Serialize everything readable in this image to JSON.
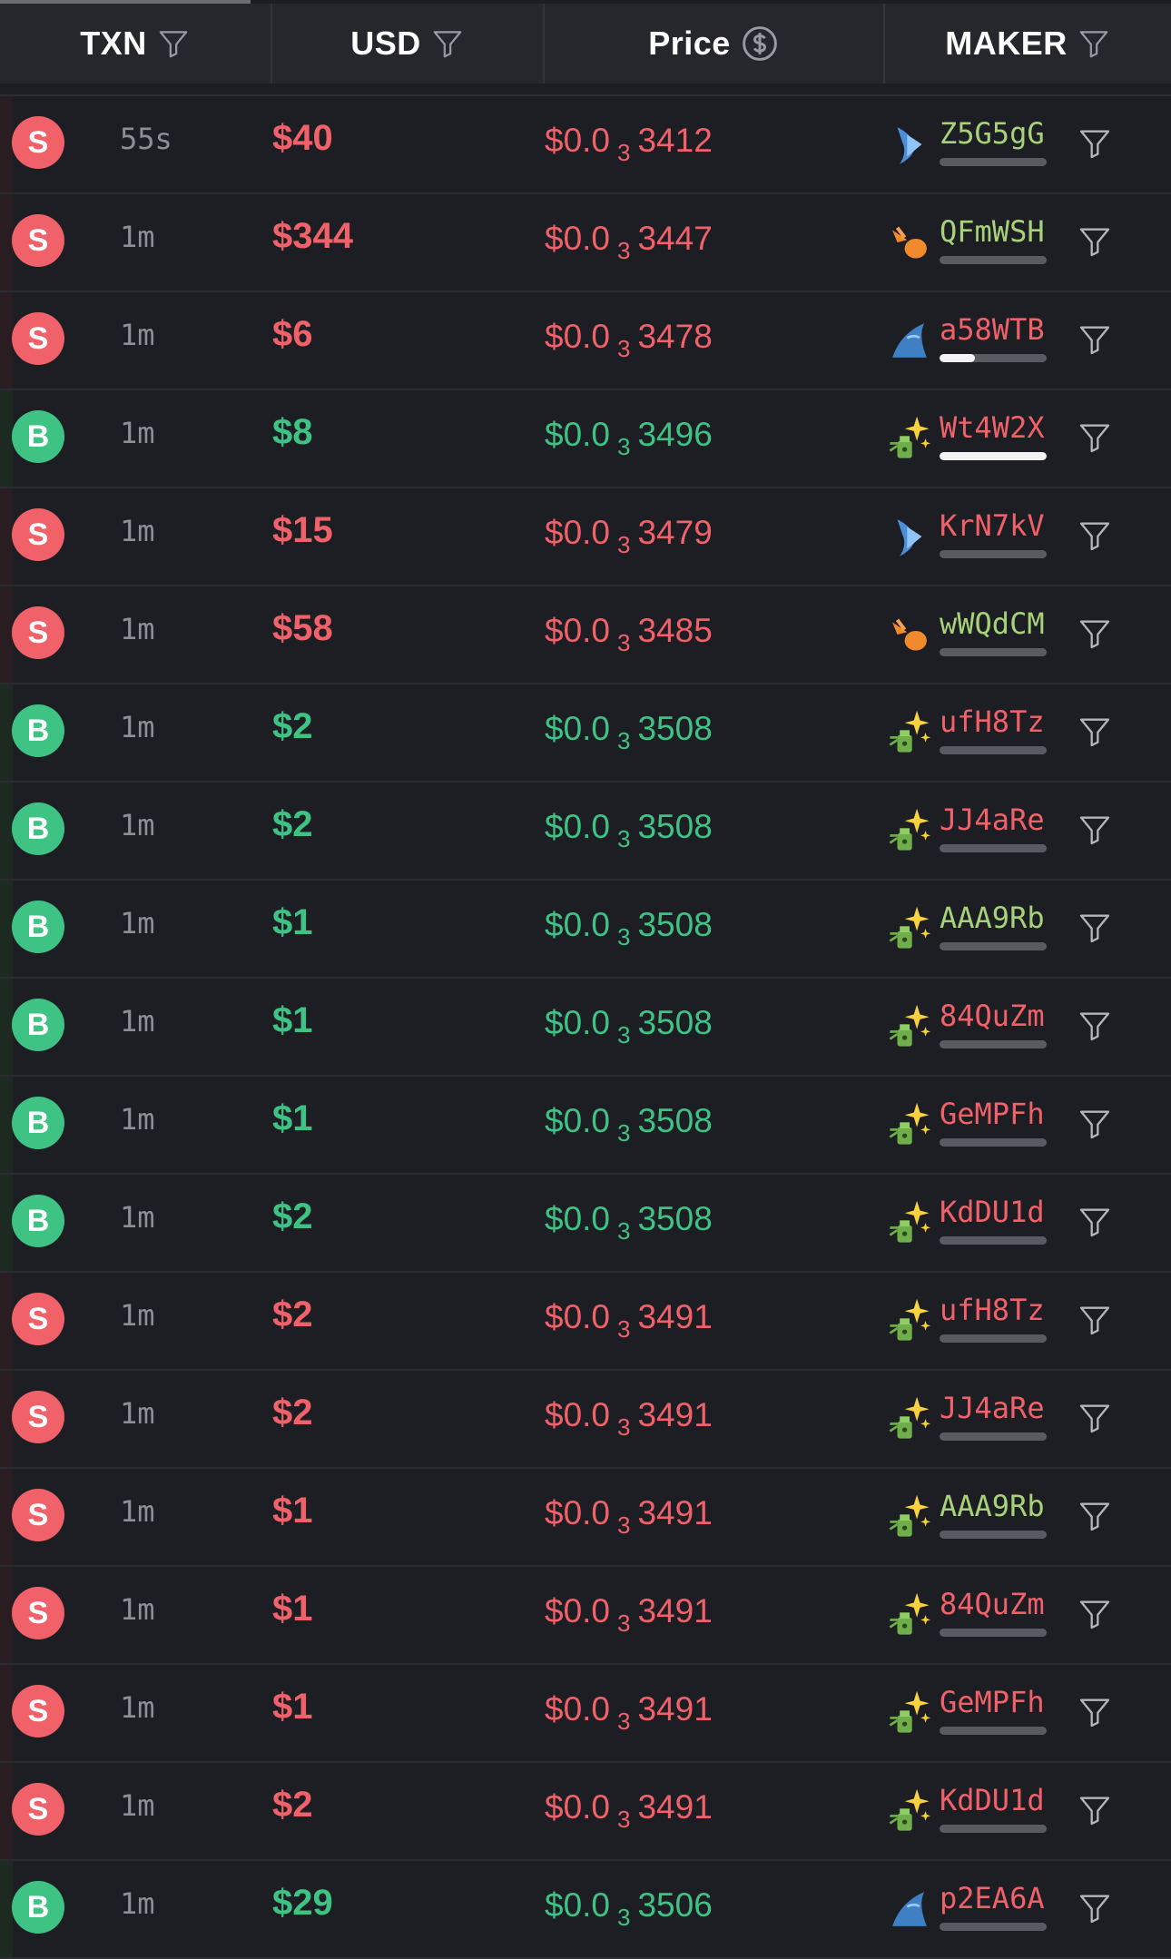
{
  "header": {
    "txn_label": "TXN",
    "usd_label": "USD",
    "price_label": "Price",
    "maker_label": "MAKER"
  },
  "colors": {
    "sell": "#f0616a",
    "buy": "#3fc384",
    "maker_green": "#a8d27a",
    "background": "#1d1e23",
    "header_bg": "#26272c"
  },
  "rows": [
    {
      "type": "S",
      "age": "55s",
      "usd": "$40",
      "price_prefix": "$0.0",
      "price_zeros": "3",
      "price_digits": "3412",
      "maker": "Z5G5gG",
      "maker_color": "green",
      "maker_icon": "dolphin-icon",
      "holding": 0
    },
    {
      "type": "S",
      "age": "1m",
      "usd": "$344",
      "price_prefix": "$0.0",
      "price_zeros": "3",
      "price_digits": "3447",
      "maker": "QFmWSH",
      "maker_color": "green",
      "maker_icon": "shrimp-icon",
      "holding": 0
    },
    {
      "type": "S",
      "age": "1m",
      "usd": "$6",
      "price_prefix": "$0.0",
      "price_zeros": "3",
      "price_digits": "3478",
      "maker": "a58WTB",
      "maker_color": "red",
      "maker_icon": "shark-icon",
      "holding": 0.33
    },
    {
      "type": "B",
      "age": "1m",
      "usd": "$8",
      "price_prefix": "$0.0",
      "price_zeros": "3",
      "price_digits": "3496",
      "maker": "Wt4W2X",
      "maker_color": "red",
      "maker_icon": "new-wallet-icon",
      "holding": 1
    },
    {
      "type": "S",
      "age": "1m",
      "usd": "$15",
      "price_prefix": "$0.0",
      "price_zeros": "3",
      "price_digits": "3479",
      "maker": "KrN7kV",
      "maker_color": "red",
      "maker_icon": "dolphin-icon",
      "holding": 0
    },
    {
      "type": "S",
      "age": "1m",
      "usd": "$58",
      "price_prefix": "$0.0",
      "price_zeros": "3",
      "price_digits": "3485",
      "maker": "wWQdCM",
      "maker_color": "green",
      "maker_icon": "shrimp-icon",
      "holding": 0
    },
    {
      "type": "B",
      "age": "1m",
      "usd": "$2",
      "price_prefix": "$0.0",
      "price_zeros": "3",
      "price_digits": "3508",
      "maker": "ufH8Tz",
      "maker_color": "red",
      "maker_icon": "new-wallet-icon",
      "holding": 0
    },
    {
      "type": "B",
      "age": "1m",
      "usd": "$2",
      "price_prefix": "$0.0",
      "price_zeros": "3",
      "price_digits": "3508",
      "maker": "JJ4aRe",
      "maker_color": "red",
      "maker_icon": "new-wallet-icon",
      "holding": 0
    },
    {
      "type": "B",
      "age": "1m",
      "usd": "$1",
      "price_prefix": "$0.0",
      "price_zeros": "3",
      "price_digits": "3508",
      "maker": "AAA9Rb",
      "maker_color": "green",
      "maker_icon": "new-wallet-icon",
      "holding": 0
    },
    {
      "type": "B",
      "age": "1m",
      "usd": "$1",
      "price_prefix": "$0.0",
      "price_zeros": "3",
      "price_digits": "3508",
      "maker": "84QuZm",
      "maker_color": "red",
      "maker_icon": "new-wallet-icon",
      "holding": 0
    },
    {
      "type": "B",
      "age": "1m",
      "usd": "$1",
      "price_prefix": "$0.0",
      "price_zeros": "3",
      "price_digits": "3508",
      "maker": "GeMPFh",
      "maker_color": "red",
      "maker_icon": "new-wallet-icon",
      "holding": 0
    },
    {
      "type": "B",
      "age": "1m",
      "usd": "$2",
      "price_prefix": "$0.0",
      "price_zeros": "3",
      "price_digits": "3508",
      "maker": "KdDU1d",
      "maker_color": "red",
      "maker_icon": "new-wallet-icon",
      "holding": 0
    },
    {
      "type": "S",
      "age": "1m",
      "usd": "$2",
      "price_prefix": "$0.0",
      "price_zeros": "3",
      "price_digits": "3491",
      "maker": "ufH8Tz",
      "maker_color": "red",
      "maker_icon": "new-wallet-icon",
      "holding": 0
    },
    {
      "type": "S",
      "age": "1m",
      "usd": "$2",
      "price_prefix": "$0.0",
      "price_zeros": "3",
      "price_digits": "3491",
      "maker": "JJ4aRe",
      "maker_color": "red",
      "maker_icon": "new-wallet-icon",
      "holding": 0
    },
    {
      "type": "S",
      "age": "1m",
      "usd": "$1",
      "price_prefix": "$0.0",
      "price_zeros": "3",
      "price_digits": "3491",
      "maker": "AAA9Rb",
      "maker_color": "green",
      "maker_icon": "new-wallet-icon",
      "holding": 0
    },
    {
      "type": "S",
      "age": "1m",
      "usd": "$1",
      "price_prefix": "$0.0",
      "price_zeros": "3",
      "price_digits": "3491",
      "maker": "84QuZm",
      "maker_color": "red",
      "maker_icon": "new-wallet-icon",
      "holding": 0
    },
    {
      "type": "S",
      "age": "1m",
      "usd": "$1",
      "price_prefix": "$0.0",
      "price_zeros": "3",
      "price_digits": "3491",
      "maker": "GeMPFh",
      "maker_color": "red",
      "maker_icon": "new-wallet-icon",
      "holding": 0
    },
    {
      "type": "S",
      "age": "1m",
      "usd": "$2",
      "price_prefix": "$0.0",
      "price_zeros": "3",
      "price_digits": "3491",
      "maker": "KdDU1d",
      "maker_color": "red",
      "maker_icon": "new-wallet-icon",
      "holding": 0
    },
    {
      "type": "B",
      "age": "1m",
      "usd": "$29",
      "price_prefix": "$0.0",
      "price_zeros": "3",
      "price_digits": "3506",
      "maker": "p2EA6A",
      "maker_color": "red",
      "maker_icon": "shark-icon",
      "holding": 0
    }
  ]
}
